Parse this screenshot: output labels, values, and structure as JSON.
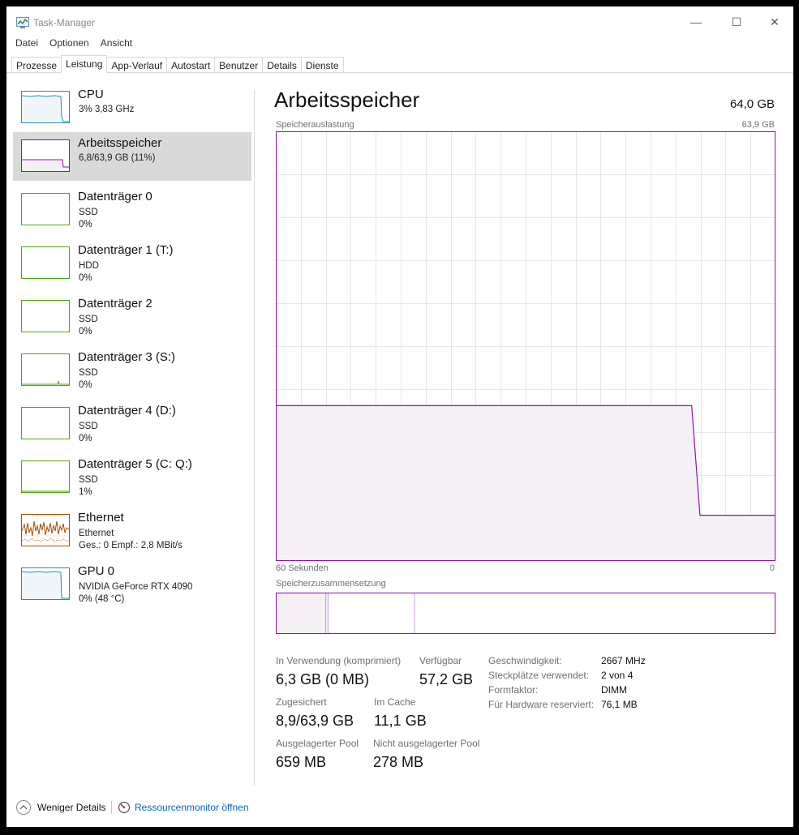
{
  "window": {
    "title": "Task-Manager",
    "min": "—",
    "max": "☐",
    "close": "✕"
  },
  "menu": [
    "Datei",
    "Optionen",
    "Ansicht"
  ],
  "tabs": [
    "Prozesse",
    "Leistung",
    "App-Verlauf",
    "Autostart",
    "Benutzer",
    "Details",
    "Dienste"
  ],
  "active_tab": "Leistung",
  "sidebar": [
    {
      "name": "CPU",
      "line1": "3%  3,83 GHz",
      "line2": "",
      "color": "#1b8fbd",
      "icon": "cpu-graph-icon"
    },
    {
      "name": "Arbeitsspeicher",
      "line1": "6,8/63,9 GB (11%)",
      "line2": "",
      "color": "#8b12ae",
      "icon": "memory-graph-icon",
      "selected": true
    },
    {
      "name": "Datenträger 0",
      "line1": "SSD",
      "line2": "0%",
      "color": "#4da60c",
      "icon": "disk-graph-icon"
    },
    {
      "name": "Datenträger 1 (T:)",
      "line1": "HDD",
      "line2": "0%",
      "color": "#4da60c",
      "icon": "disk-graph-icon"
    },
    {
      "name": "Datenträger 2",
      "line1": "SSD",
      "line2": "0%",
      "color": "#4da60c",
      "icon": "disk-graph-icon"
    },
    {
      "name": "Datenträger 3 (S:)",
      "line1": "SSD",
      "line2": "0%",
      "color": "#4da60c",
      "icon": "disk-graph-icon"
    },
    {
      "name": "Datenträger 4 (D:)",
      "line1": "SSD",
      "line2": "0%",
      "color": "#4da60c",
      "icon": "disk-graph-icon"
    },
    {
      "name": "Datenträger 5 (C: Q:)",
      "line1": "SSD",
      "line2": "1%",
      "color": "#4da60c",
      "icon": "disk-graph-icon"
    },
    {
      "name": "Ethernet",
      "line1": "Ethernet",
      "line2": "Ges.: 0  Empf.: 2,8 MBit/s",
      "color": "#a74f01",
      "icon": "network-graph-icon"
    },
    {
      "name": "GPU 0",
      "line1": "NVIDIA GeForce RTX 4090",
      "line2": "0%  (48 °C)",
      "color": "#1b8fbd",
      "icon": "gpu-graph-icon"
    }
  ],
  "main": {
    "title": "Arbeitsspeicher",
    "total": "64,0 GB",
    "usage_label": "Speicherauslastung",
    "usage_max": "63,9 GB",
    "axis_left": "60 Sekunden",
    "axis_right": "0",
    "composition_label": "Speicherzusammensetzung",
    "color": "#8b12ae",
    "fill": "#f4f0f6"
  },
  "usage_graph": {
    "x_max_seconds": 60,
    "y_max_gb": 63.9,
    "samples_gb": [
      23.1,
      23.1,
      23.1,
      23.1,
      23.1,
      23.1,
      23.1,
      23.1,
      23.1,
      23.1,
      23.1,
      23.1,
      23.1,
      23.1,
      23.1,
      23.1,
      23.1,
      23.1,
      23.1,
      23.1,
      23.1,
      23.1,
      23.1,
      23.1,
      23.1,
      23.1,
      23.1,
      23.1,
      23.1,
      23.1,
      23.1,
      23.1,
      23.1,
      23.1,
      23.1,
      23.1,
      23.1,
      23.1,
      23.1,
      23.1,
      23.1,
      23.1,
      23.1,
      23.1,
      23.1,
      23.1,
      23.1,
      23.1,
      23.1,
      23.1,
      23.1,
      6.8,
      6.8,
      6.8,
      6.8,
      6.8,
      6.8,
      6.8,
      6.8,
      6.8,
      6.8
    ]
  },
  "composition": {
    "in_use_gb": 6.3,
    "modified_gb": 0.3,
    "standby_gb": 11.1,
    "free_gb": 45.9,
    "total_gb": 63.9
  },
  "stats": {
    "in_use_label": "In Verwendung (komprimiert)",
    "in_use_value": "6,3 GB (0 MB)",
    "available_label": "Verfügbar",
    "available_value": "57,2 GB",
    "committed_label": "Zugesichert",
    "committed_value": "8,9/63,9 GB",
    "cached_label": "Im Cache",
    "cached_value": "11,1 GB",
    "paged_label": "Ausgelagerter Pool",
    "paged_value": "659 MB",
    "nonpaged_label": "Nicht ausgelagerter Pool",
    "nonpaged_value": "278 MB"
  },
  "details": [
    {
      "key": "Geschwindigkeit:",
      "value": "2667 MHz"
    },
    {
      "key": "Steckplätze verwendet:",
      "value": "2 von 4"
    },
    {
      "key": "Formfaktor:",
      "value": "DIMM"
    },
    {
      "key": "Für Hardware reserviert:",
      "value": "76,1 MB"
    }
  ],
  "footer": {
    "less_details": "Weniger Details",
    "resource_monitor": "Ressourcenmonitor öffnen"
  }
}
